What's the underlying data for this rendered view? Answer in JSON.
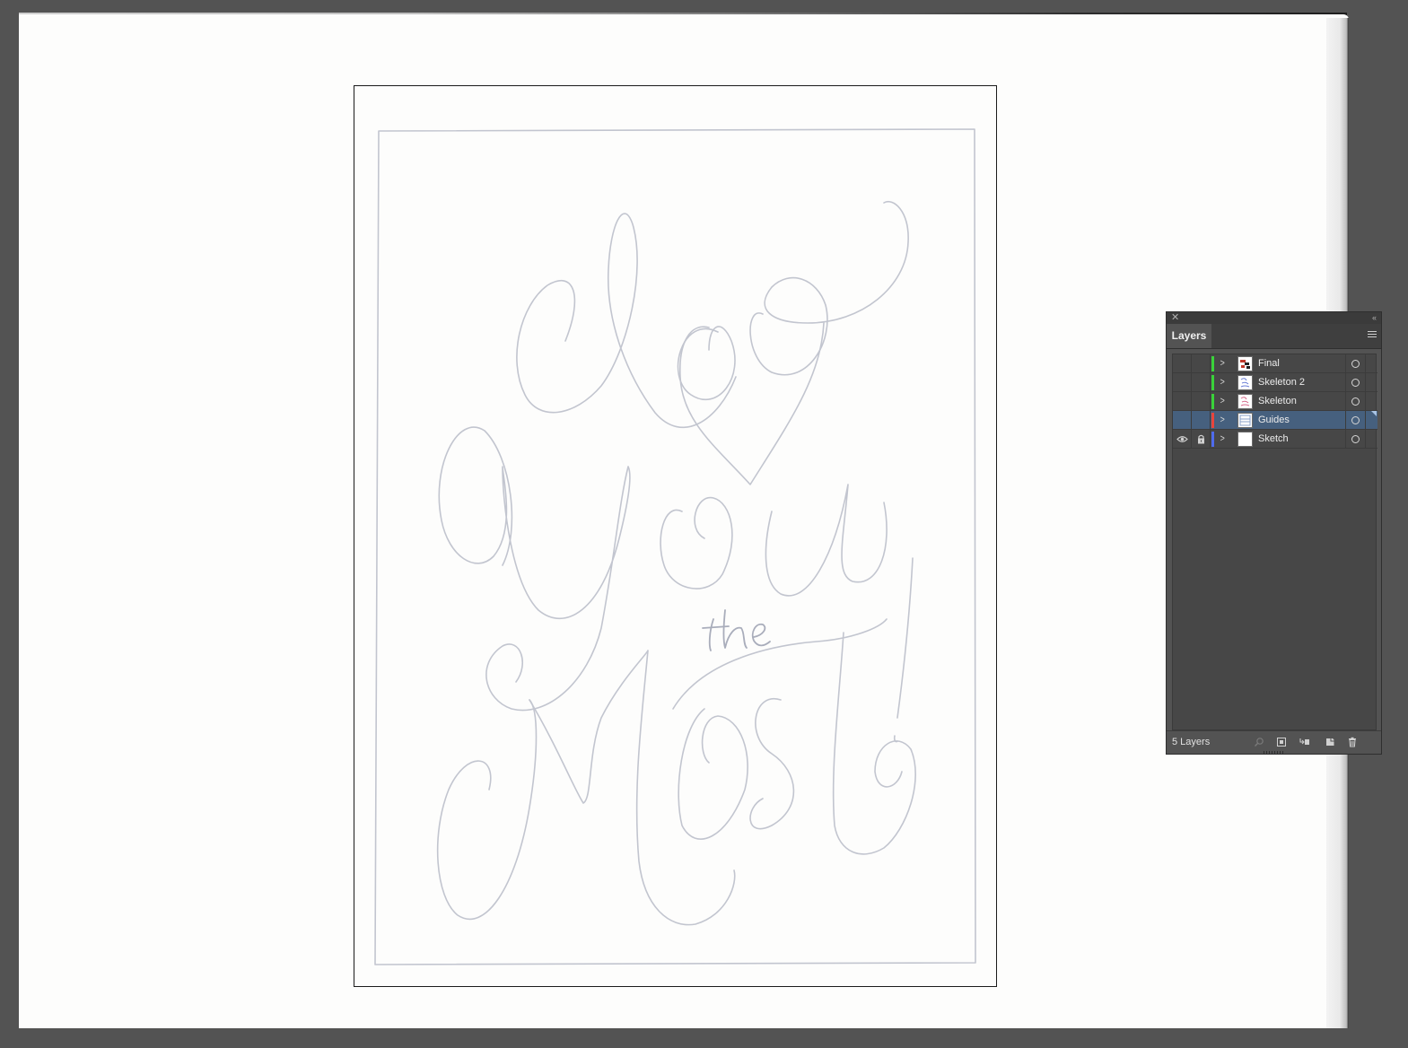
{
  "panel": {
    "tab_label": "Layers",
    "layer_count_label": "5 Layers",
    "colors": {
      "panel_bg": "#535353",
      "selected_row": "#46607e"
    }
  },
  "layers": [
    {
      "name": "Final",
      "color": "#3ad23a",
      "visible": false,
      "locked": false,
      "selected": false,
      "thumb": "final-thumb-icon"
    },
    {
      "name": "Skeleton 2",
      "color": "#3ad23a",
      "visible": false,
      "locked": false,
      "selected": false,
      "thumb": "skeleton2-thumb-icon"
    },
    {
      "name": "Skeleton",
      "color": "#3ad23a",
      "visible": false,
      "locked": false,
      "selected": false,
      "thumb": "skeleton-thumb-icon"
    },
    {
      "name": "Guides",
      "color": "#e8453c",
      "visible": false,
      "locked": false,
      "selected": true,
      "thumb": "guides-thumb-icon"
    },
    {
      "name": "Sketch",
      "color": "#4f6bed",
      "visible": true,
      "locked": true,
      "selected": false,
      "thumb": "sketch-thumb-icon"
    }
  ],
  "sketch": {
    "words": [
      "do",
      "you",
      "the",
      "most!"
    ],
    "pencil_color": "#b9bcc8"
  }
}
